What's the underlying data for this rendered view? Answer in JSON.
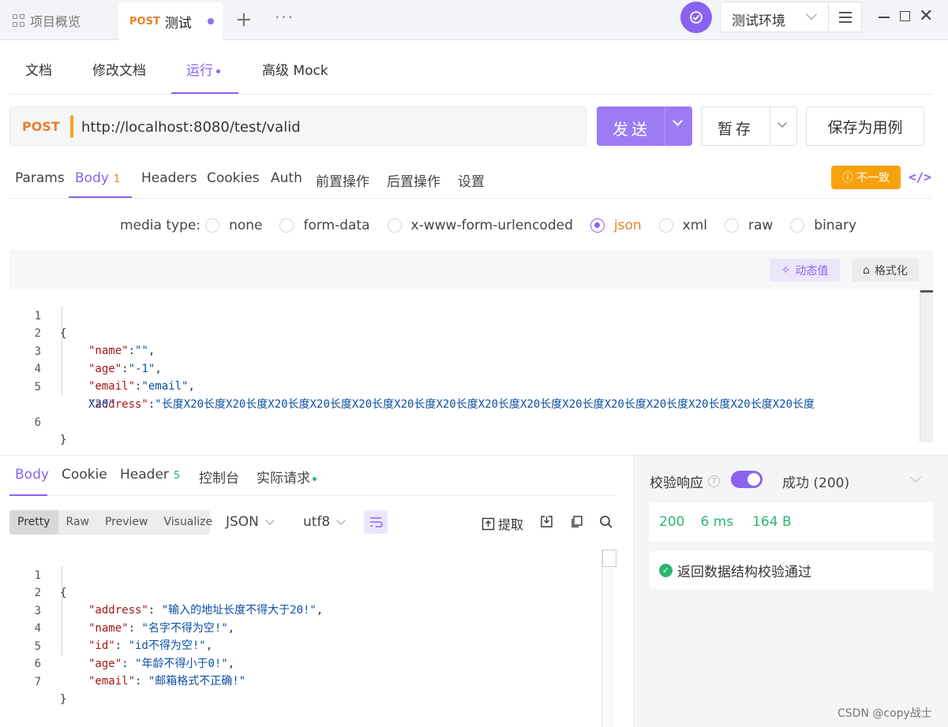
{
  "titlebar": {
    "overview_tab": "项目概览",
    "active_tab": {
      "method": "POST",
      "name": "测试"
    },
    "plus": "+",
    "more": "···",
    "environment": "测试环境"
  },
  "subnav": {
    "items": [
      "文档",
      "修改文档",
      "运行",
      "高级 Mock"
    ],
    "active_index": 2
  },
  "request": {
    "method": "POST",
    "url": "http://localhost:8080/test/valid",
    "send_label": "发送",
    "stash_label": "暂存",
    "save_case_label": "保存为用例"
  },
  "req_tabs": {
    "items": [
      "Params",
      "Body",
      "Headers",
      "Cookies",
      "Auth",
      "前置操作",
      "后置操作",
      "设置"
    ],
    "body_count": "1",
    "diff_badge": "不一致",
    "code_icon": "</>"
  },
  "media": {
    "label": "media type:",
    "options": [
      "none",
      "form-data",
      "x-www-form-urlencoded",
      "json",
      "xml",
      "raw",
      "binary"
    ],
    "selected": "json"
  },
  "editor": {
    "dynamic_value": "动态值",
    "format": "格式化",
    "lines": [
      {
        "no": "1",
        "text": "{"
      },
      {
        "no": "2",
        "key": "\"name\"",
        "sep": ":",
        "val": "\"\"",
        "end": ","
      },
      {
        "no": "3",
        "key": "\"age\"",
        "sep": ":",
        "val": "\"-1\"",
        "end": ","
      },
      {
        "no": "4",
        "key": "\"email\"",
        "sep": ":",
        "val": "\"email\"",
        "end": ","
      },
      {
        "no": "5",
        "key": "\"address\"",
        "sep": ":",
        "val": "\"长度X20长度X20长度X20长度X20长度X20长度X20长度X20长度X20长度X20长度X20长度X20长度X20长度X20长度X20长度X20长度",
        "cont": "X20\""
      },
      {
        "no": "6",
        "text": "}"
      }
    ]
  },
  "response": {
    "tabs": [
      "Body",
      "Cookie",
      "Header",
      "控制台",
      "实际请求"
    ],
    "header_count": "5",
    "views": [
      "Pretty",
      "Raw",
      "Preview",
      "Visualize"
    ],
    "active_view": "Pretty",
    "format": "JSON",
    "encoding": "utf8",
    "extract": "提取",
    "lines": [
      {
        "no": "1",
        "text": "{"
      },
      {
        "no": "2",
        "key": "\"address\"",
        "val": "\"输入的地址长度不得大于20!\"",
        "end": ","
      },
      {
        "no": "3",
        "key": "\"name\"",
        "val": "\"名字不得为空!\"",
        "end": ","
      },
      {
        "no": "4",
        "key": "\"id\"",
        "val": "\"id不得为空!\"",
        "end": ","
      },
      {
        "no": "5",
        "key": "\"age\"",
        "val": "\"年龄不得小于0!\"",
        "end": ","
      },
      {
        "no": "6",
        "key": "\"email\"",
        "val": "\"邮箱格式不正确!\"",
        "end": ""
      },
      {
        "no": "7",
        "text": "}"
      }
    ]
  },
  "validation": {
    "label": "校验响应",
    "result": "成功 (200)",
    "status": "200",
    "time": "6 ms",
    "size": "164 B",
    "message": "返回数据结构校验通过"
  },
  "watermark": "CSDN @copy战士",
  "colors": {
    "accent": "#8b62f0",
    "post": "#e8812b",
    "success": "#2bb673",
    "warning": "#f7a20d"
  }
}
